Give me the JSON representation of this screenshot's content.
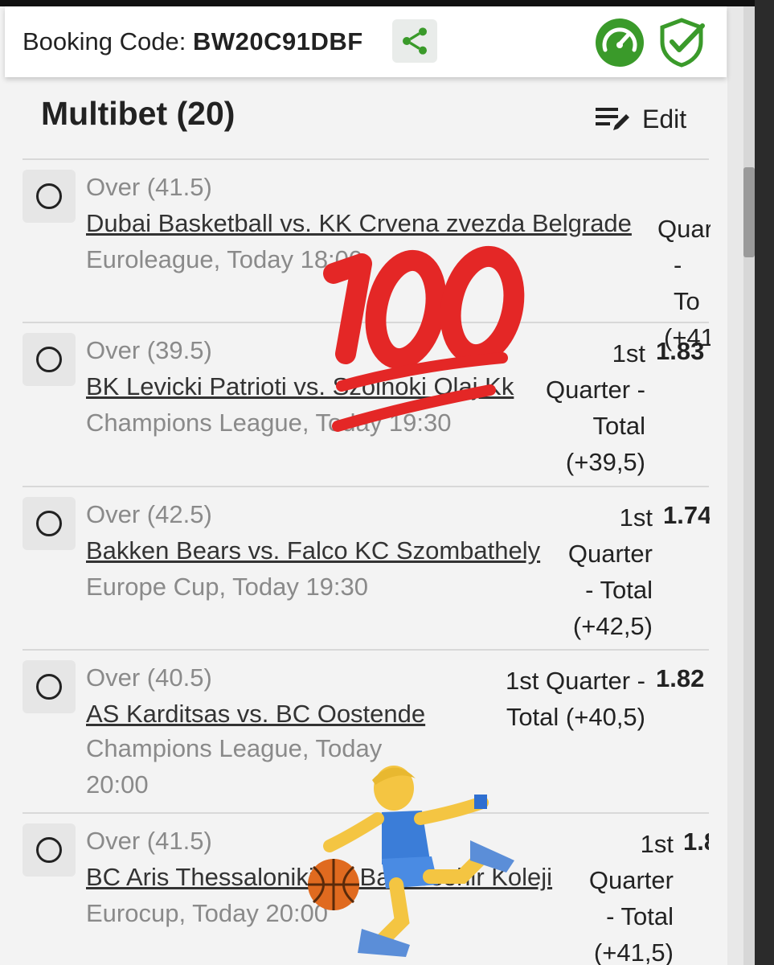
{
  "header": {
    "booking_label": "Booking Code: ",
    "booking_code": "BW20C91DBF",
    "share_icon": "share-icon",
    "gauge_icon": "speedometer-icon",
    "shield_icon": "shield-check-icon",
    "accent_color": "#3a9a2a"
  },
  "betslip": {
    "title": "Multibet (20)",
    "edit_label": "Edit",
    "edit_icon": "edit-list-icon"
  },
  "bets": [
    {
      "selection": "Over (41.5)",
      "match": "Dubai Basketball vs. KK Crvena zvezda Belgrade",
      "league": "Euroleague, Today 18:00",
      "market_lines": [
        "Quar",
        "- To",
        "(+41"
      ],
      "odds": ""
    },
    {
      "selection": "Over (39.5)",
      "match": "BK Levicki Patrioti vs. Szolnoki Olaj Kk",
      "league": "Champions League, Today 19:30",
      "market_lines": [
        "1st",
        "Quarter -",
        "Total",
        "(+39,5)"
      ],
      "odds": "1.83"
    },
    {
      "selection": "Over (42.5)",
      "match": "Bakken Bears vs. Falco KC Szombathely",
      "league": "Europe Cup, Today 19:30",
      "market_lines": [
        "1st",
        "Quarter",
        "- Total",
        "(+42,5)"
      ],
      "odds": "1.74"
    },
    {
      "selection": "Over (40.5)",
      "match": "AS Karditsas vs. BC Oostende",
      "league_lines": [
        "Champions League, Today",
        "20:00"
      ],
      "market_lines": [
        "1st Quarter -",
        "Total (+40,5)"
      ],
      "odds": "1.82"
    },
    {
      "selection": "Over (41.5)",
      "match": "BC Aris Thessaloniki vs. Bahcesehir Koleji",
      "league": "Eurocup, Today 20:00",
      "market_lines": [
        "1st",
        "Quarter",
        "- Total",
        "(+41,5)"
      ],
      "odds": "1.8"
    }
  ],
  "stickers": {
    "hundred": "hundred-points-emoji",
    "player": "basketball-player-emoji"
  }
}
